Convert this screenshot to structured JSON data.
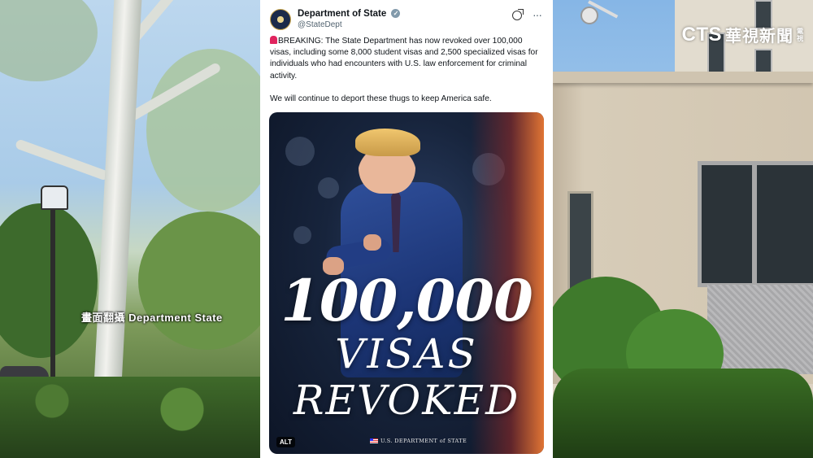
{
  "overlay": {
    "caption": "畫面翻攝 Department State"
  },
  "logo": {
    "latin": "CTS",
    "chinese": "華視新聞",
    "mini": "電視"
  },
  "tweet": {
    "author_name": "Department of State",
    "author_handle": "@StateDept",
    "verified_badge": "✓",
    "more_icon": "···",
    "paragraph1": "BREAKING: The State Department has now revoked over 100,000 visas, including some 8,000 student visas and 2,500 specialized visas for individuals who had encounters with U.S. law enforcement for criminal activity.",
    "paragraph2": "We will continue to deport these thugs to keep America safe.",
    "image": {
      "headline_number": "100,000",
      "headline_line2": "VISAS",
      "headline_line3": "REVOKED",
      "alt_label": "ALT",
      "footer": "U.S. DEPARTMENT of STATE"
    }
  },
  "colors": {
    "tweet_bg": "#ffffff",
    "text": "#0f1419",
    "handle": "#536471",
    "siren": "#e0245e"
  },
  "icons": [
    "siren-icon",
    "verified-badge-icon",
    "grok-icon",
    "more-icon",
    "flag-icon"
  ]
}
